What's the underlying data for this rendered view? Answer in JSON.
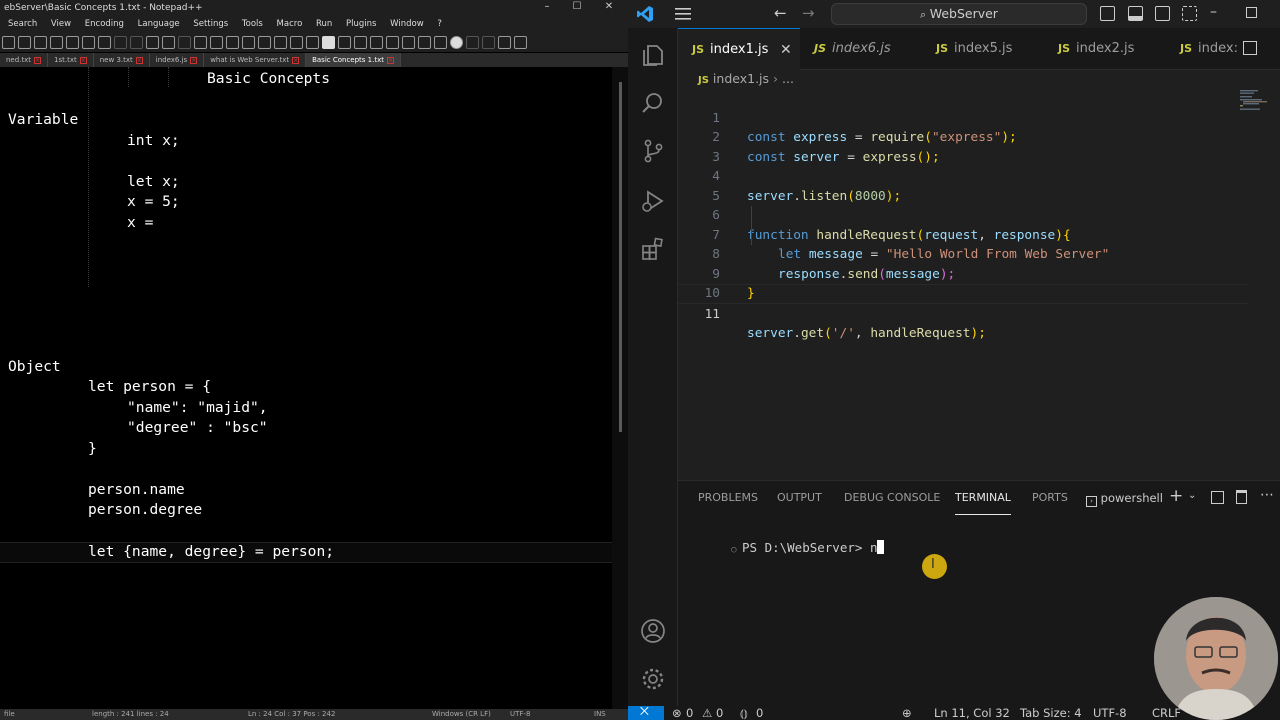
{
  "npp": {
    "title": "ebServer\\Basic Concepts 1.txt - Notepad++",
    "menu": [
      "Search",
      "View",
      "Encoding",
      "Language",
      "Settings",
      "Tools",
      "Macro",
      "Run",
      "Plugins",
      "Window",
      "?"
    ],
    "tabs": [
      "ned.txt",
      "1st.txt",
      "new 3.txt",
      "index6.js",
      "what is Web Server.txt",
      "Basic Concepts 1.txt"
    ],
    "lines": {
      "l1": "Basic Concepts",
      "l2": "Variable",
      "l3": "int x;",
      "l4": "let x;",
      "l5": "x = 5;",
      "l6": "x =",
      "l7": "Object",
      "l8": "let person = {",
      "l9": "\"name\": \"majid\",",
      "l10": "\"degree\" : \"bsc\"",
      "l11": "}",
      "l12": "person.name",
      "l13": "person.degree",
      "l14": "let {name, degree} = person;"
    },
    "status": {
      "file_type": "file",
      "length": "length : 241    lines : 24",
      "position": "Ln : 24    Col : 37    Pos : 242",
      "eol": "Windows (CR LF)",
      "encoding": "UTF-8",
      "mode": "INS"
    }
  },
  "vscode": {
    "search_placeholder": "WebServer",
    "tabs": [
      "index1.js",
      "index6.js",
      "index5.js",
      "index2.js",
      "index:"
    ],
    "tab_prefix": "JS",
    "breadcrumb_file": "index1.js",
    "breadcrumb_more": "...",
    "line_numbers": [
      "1",
      "2",
      "3",
      "4",
      "5",
      "6",
      "7",
      "8",
      "9",
      "10",
      "11"
    ],
    "panel_tabs": [
      "PROBLEMS",
      "OUTPUT",
      "DEBUG CONSOLE",
      "TERMINAL",
      "PORTS"
    ],
    "terminal_shell": "powershell",
    "terminal_prompt": "PS D:\\WebServer> ",
    "terminal_input": "n",
    "status": {
      "errors": "0",
      "warnings": "0",
      "ports": "0",
      "position": "Ln 11, Col 32",
      "tab_size": "Tab Size: 4",
      "encoding": "UTF-8",
      "eol": "CRLF"
    },
    "code": {
      "c1_kw": "const",
      "c1_var": "express",
      "c1_op": " = ",
      "c1_fn": "require",
      "c1_str": "\"express\"",
      "c1_end": ");",
      "c2_kw": "const",
      "c2_var": "server",
      "c2_op": " = ",
      "c2_fn": "express",
      "c2_end": "();",
      "c4_var": "server",
      "c4_dot": ".",
      "c4_fn": "listen",
      "c4_num": "8000",
      "c4_end": ");",
      "c6_kw": "function",
      "c6_fn": "handleRequest",
      "c6_p1": "request",
      "c6_comma": ", ",
      "c6_p2": "response",
      "c6_end": "){",
      "c7_kw": "let",
      "c7_var": "message",
      "c7_op": " = ",
      "c7_str": "\"Hello World From Web Server\"",
      "c8_var": "response",
      "c8_dot": ".",
      "c8_fn": "send",
      "c8_arg": "message",
      "c8_end": ");",
      "c9": "}",
      "c11_var": "server",
      "c11_dot": ".",
      "c11_fn": "get",
      "c11_str": "'/'",
      "c11_comma": ", ",
      "c11_arg": "handleRequest",
      "c11_end": ");"
    }
  },
  "colors": {
    "vscode_accent": "#0078d4",
    "js_icon": "#cbcb41",
    "cursor_highlight": "#e1b70f"
  }
}
